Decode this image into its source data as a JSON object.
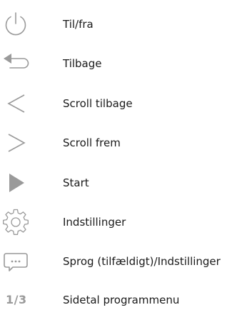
{
  "colors": {
    "icon_gray": "#9a9a9a",
    "text": "#1a1a1a",
    "background": "#ffffff"
  },
  "legend": {
    "items": [
      {
        "icon": "power-icon",
        "label": "Til/fra"
      },
      {
        "icon": "back-arrow-icon",
        "label": "Tilbage"
      },
      {
        "icon": "chevron-left-icon",
        "label": "Scroll tilbage"
      },
      {
        "icon": "chevron-right-icon",
        "label": "Scroll frem"
      },
      {
        "icon": "play-icon",
        "label": "Start"
      },
      {
        "icon": "gear-icon",
        "label": "Indstillinger"
      },
      {
        "icon": "speech-bubble-icon",
        "label": "Sprog (tilfældigt)/Indstillinger"
      },
      {
        "icon": "page-number-icon",
        "label": "Sidetal programmenu",
        "icon_text": "1/3"
      }
    ]
  }
}
